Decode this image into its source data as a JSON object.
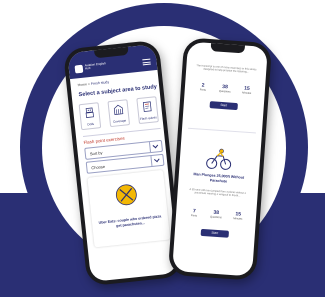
{
  "left_phone": {
    "app_logo_text": "Aviation English Hub",
    "breadcrumb": {
      "home": "Home",
      "separator": " > ",
      "current": "Fresh study"
    },
    "select_subject_title": "Select a subject area to study",
    "subject_cards": [
      {
        "label": "Dolls",
        "icon": "robot-icon"
      },
      {
        "label": "Coverage",
        "icon": "building-icon"
      },
      {
        "label": "Flash quizes",
        "icon": "book-icon"
      }
    ],
    "section_title": "Flash point exercises",
    "sort_dropdown": {
      "label": "Sort by"
    },
    "choose_dropdown": {
      "label": "Choose"
    },
    "exercise_card": {
      "title": "Uber Eats: couple who ordered pizza get parachuten...",
      "icon": "pizza-cutlery-icon"
    }
  },
  "right_phone": {
    "top_text": "The transcript is one of many exercises in this series designed to help practise the listening...",
    "stats_top": [
      {
        "value": "2",
        "label": "Parts"
      },
      {
        "value": "38",
        "label": "Questions"
      },
      {
        "value": "15",
        "label": "Minutes"
      }
    ],
    "start_label": "Start",
    "card_icon": "cyclist-icon",
    "card_title": "Man Plunges 25,000ft Without Parachute",
    "card_text": "A 35-year-old man jumped from a plane without a parachute wearing a wingsuit to break...",
    "stats_bottom": [
      {
        "value": "7",
        "label": "Parts"
      },
      {
        "value": "38",
        "label": "Questions"
      },
      {
        "value": "15",
        "label": "Minutes"
      }
    ],
    "start_label_2": "Start"
  },
  "colors": {
    "navy": "#2a2f74",
    "accent_red": "#c0392b",
    "icon_yellow": "#f2b705"
  }
}
